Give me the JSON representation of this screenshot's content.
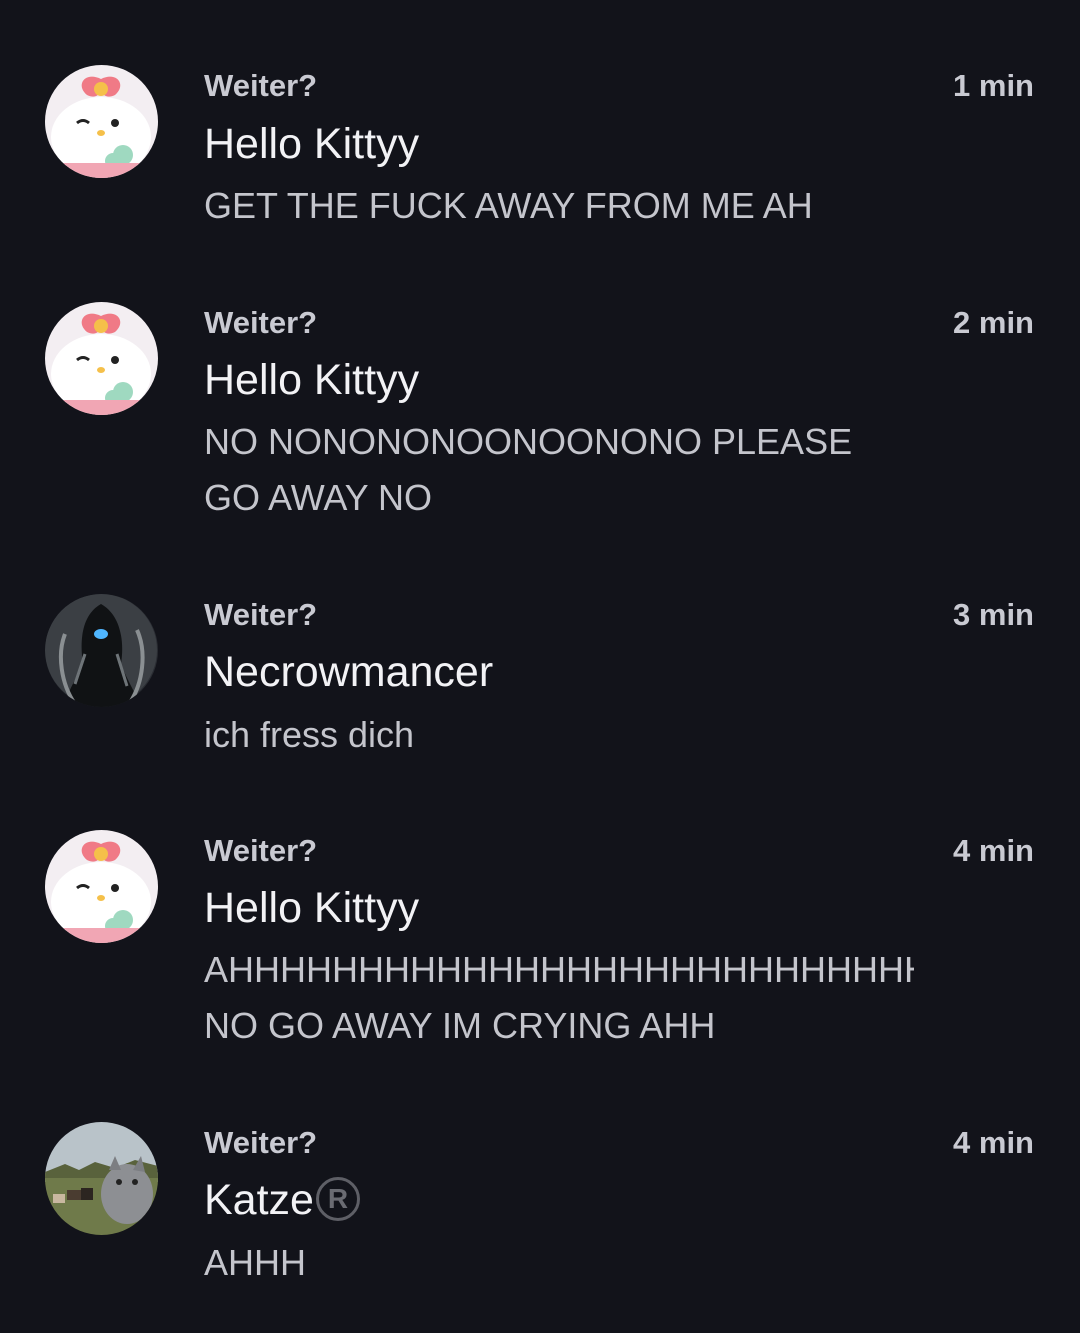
{
  "notifications": [
    {
      "app": "Weiter?",
      "time": "1 min",
      "sender": "Hello Kittyy",
      "avatar": "hello-kitty-avatar",
      "lines": [
        "GET THE FUCK AWAY FROM ME AH"
      ]
    },
    {
      "app": "Weiter?",
      "time": "2 min",
      "sender": "Hello Kittyy",
      "avatar": "hello-kitty-avatar",
      "lines": [
        "NO NONONONOONOONONO PLEASE",
        "GO AWAY NO"
      ]
    },
    {
      "app": "Weiter?",
      "time": "3 min",
      "sender": "Necrowmancer",
      "avatar": "necromancer-avatar",
      "lines": [
        "ich fress dich"
      ]
    },
    {
      "app": "Weiter?",
      "time": "4 min",
      "sender": "Hello Kittyy",
      "avatar": "hello-kitty-avatar",
      "lines": [
        "AHHHHHHHHHHHHHHHHHHHHHHHHHHHH",
        "NO GO AWAY IM CRYING AHH"
      ]
    },
    {
      "app": "Weiter?",
      "time": "4 min",
      "sender": "Katze",
      "sender_badge": "R",
      "avatar": "cat-avatar",
      "lines": [
        "AHHH"
      ]
    }
  ],
  "colors": {
    "background": "#12131a",
    "sender_text": "#f2f2f5",
    "secondary_text": "#c9cad2"
  }
}
